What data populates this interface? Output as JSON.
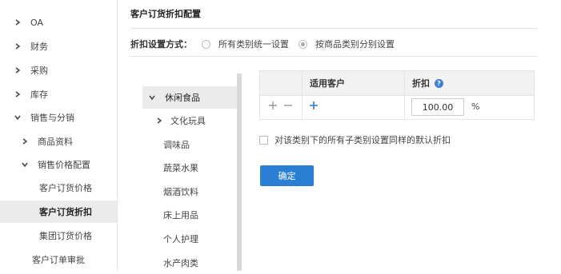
{
  "sidebar": {
    "items": [
      {
        "label": "OA",
        "expanded": false
      },
      {
        "label": "财务",
        "expanded": false
      },
      {
        "label": "采购",
        "expanded": false
      },
      {
        "label": "库存",
        "expanded": false
      },
      {
        "label": "销售与分销",
        "expanded": true
      },
      {
        "label": "商品资料",
        "expanded": false
      },
      {
        "label": "销售价格配置",
        "expanded": true
      },
      {
        "label": "客户订货价格"
      },
      {
        "label": "客户订货折扣",
        "active": true
      },
      {
        "label": "集团订货价格"
      },
      {
        "label": "客户订单审批"
      }
    ]
  },
  "main": {
    "title": "客户订货折扣配置",
    "discount_mode": {
      "label": "折扣设置方式：",
      "options": [
        {
          "label": "所有类别统一设置",
          "checked": false
        },
        {
          "label": "按商品类别分别设置",
          "checked": true
        }
      ]
    },
    "categories": [
      {
        "label": "休闲食品",
        "expanded": true,
        "selected": true
      },
      {
        "label": "文化玩具",
        "expanded": false
      },
      {
        "label": "调味品"
      },
      {
        "label": "蔬菜水果"
      },
      {
        "label": "烟酒饮料"
      },
      {
        "label": "床上用品"
      },
      {
        "label": "个人护理"
      },
      {
        "label": "水产肉类"
      }
    ],
    "table": {
      "headers": [
        "",
        "适用客户",
        "折扣"
      ],
      "rows": [
        {
          "customer": "",
          "discount": "100.00",
          "unit": "%"
        }
      ]
    },
    "checkbox": {
      "label": "对该类别下的所有子类别设置同样的默认折扣",
      "checked": false
    },
    "confirm_label": "确定"
  },
  "colors": {
    "accent": "#2a7fd4",
    "help": "#3a82d6",
    "active_bg": "#ebebeb"
  }
}
